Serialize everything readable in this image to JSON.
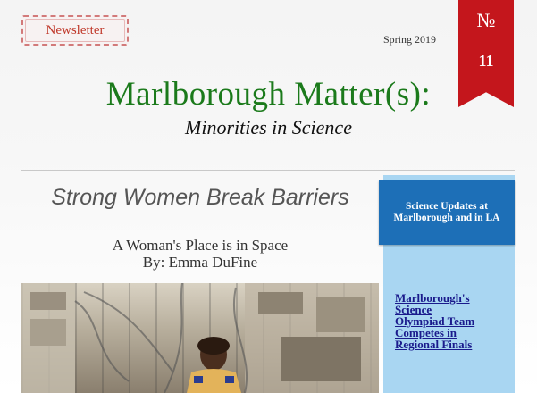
{
  "header": {
    "stamp_label": "Newsletter",
    "season": "Spring 2019",
    "issue_symbol": "№",
    "issue_number": "11",
    "title": "Marlborough Matter(s):",
    "subtitle": "Minorities in Science"
  },
  "main": {
    "headline": "Strong Women Break Barriers",
    "article_title": "A Woman's Place is in Space",
    "byline": "By: Emma DuFine"
  },
  "sidebar": {
    "heading": "Science Updates at Marlborough and in LA",
    "link_text": "Marlborough's Science Olympiad Team Competes in Regional Finals"
  },
  "colors": {
    "title_green": "#1b7a1b",
    "ribbon_red": "#c4161c",
    "sidebar_blue": "#1d6fb7",
    "sidebar_light": "#a9d6f2"
  }
}
